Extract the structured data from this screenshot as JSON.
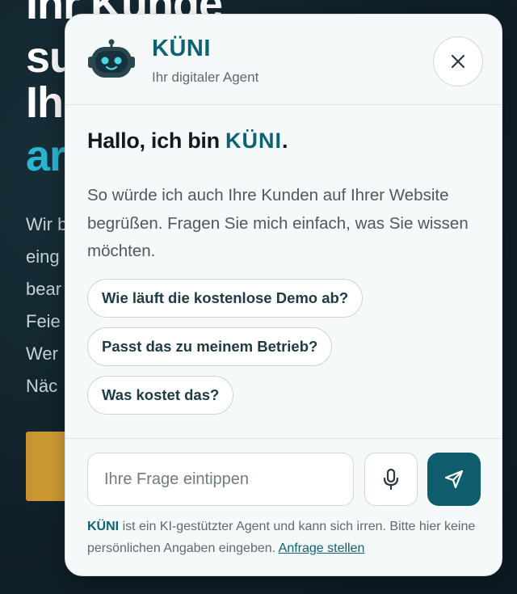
{
  "background": {
    "heading_lines": [
      "Ihr Kunde",
      "su",
      "Ih",
      "ar"
    ],
    "body_lines": [
      "Wir b",
      "eing",
      "bear",
      "Feie",
      "Wer",
      "Näc"
    ],
    "accent_color": "#29b6d3",
    "cta_color": "#d9a237"
  },
  "chat": {
    "header": {
      "name": "KÜNI",
      "subtitle": "Ihr digitaler Agent",
      "avatar_icon": "robot-icon",
      "close_icon": "close-icon"
    },
    "greeting": {
      "prefix": "Hallo, ich bin",
      "name": "KÜNI",
      "suffix": "."
    },
    "intro_text": "So würde ich auch Ihre Kunden auf Ihrer Website begrüßen. Fragen Sie mich einfach, was Sie wissen möchten.",
    "suggestions": [
      "Wie läuft die kostenlose Demo ab?",
      "Passt das zu meinem Betrieb?",
      "Was kostet das?"
    ],
    "input": {
      "placeholder": "Ihre Frage eintippen",
      "value": ""
    },
    "mic_icon": "microphone-icon",
    "send_icon": "send-icon",
    "disclaimer": {
      "brand": "KÜNI",
      "text": "ist ein KI-gestützter Agent und kann sich irren. Bitte hier keine persönlichen Angaben eingeben.",
      "link": "Anfrage stellen"
    },
    "colors": {
      "primary": "#0f6272",
      "send_button": "#0e5d6d",
      "panel": "#f5f9fa"
    }
  }
}
